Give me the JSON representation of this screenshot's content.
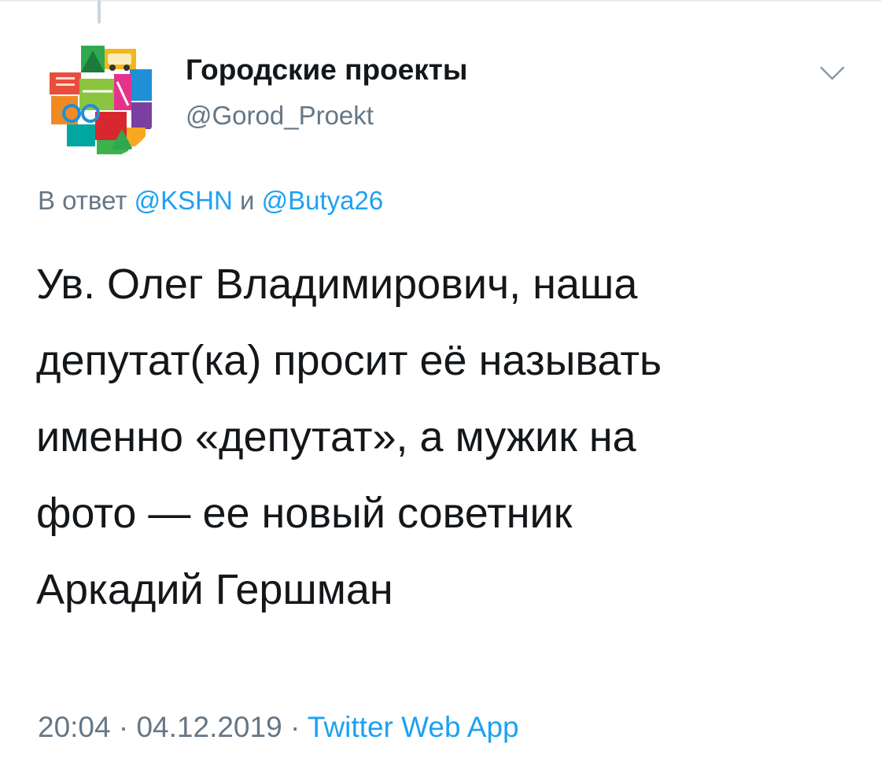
{
  "author": {
    "display_name": "Городские проекты",
    "handle": "@Gorod_Proekt"
  },
  "reply": {
    "prefix": "В ответ",
    "mention_1": "@KSHN",
    "conjunction": "и",
    "mention_2": "@Butya26"
  },
  "tweet": {
    "lines": [
      "Ув. Олег Владимирович, наша",
      "депутат(ка) просит её называть",
      "именно «депутат», а мужик на",
      "фото — ее новый советник",
      "Аркадий Гершман"
    ]
  },
  "meta": {
    "time": "20:04",
    "separator_1": "·",
    "date": "04.12.2019",
    "separator_2": "·",
    "source": "Twitter Web App"
  },
  "colors": {
    "link": "#1da1f2",
    "secondary_text": "#657786",
    "primary_text": "#14171a"
  },
  "icons": {
    "menu": "chevron-down-icon",
    "avatar": "city-projects-logo"
  }
}
